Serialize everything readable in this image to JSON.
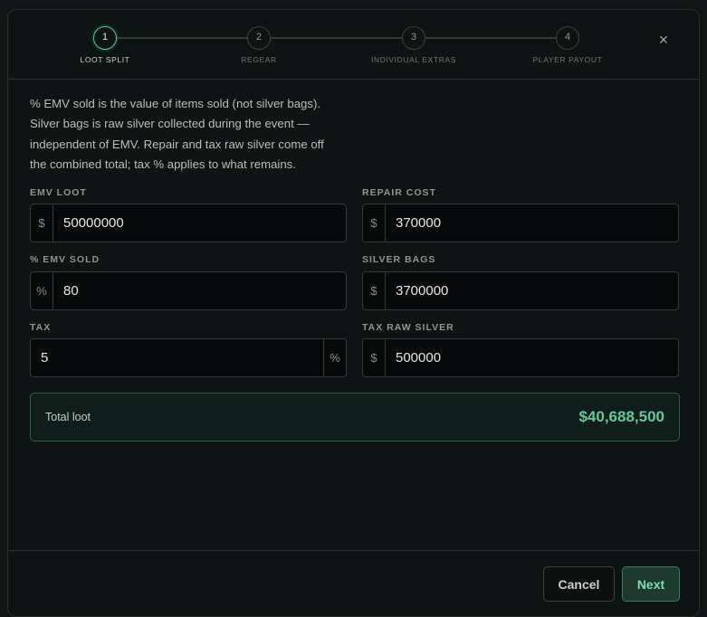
{
  "stepper": {
    "steps": [
      {
        "number": "1",
        "label": "LOOT SPLIT"
      },
      {
        "number": "2",
        "label": "REGEAR"
      },
      {
        "number": "3",
        "label": "INDIVIDUAL EXTRAS"
      },
      {
        "number": "4",
        "label": "PLAYER PAYOUT"
      }
    ],
    "active_step": 1,
    "close_symbol": "×"
  },
  "description": {
    "line1": "% EMV sold is the value of items sold (not silver bags).",
    "line2": "Silver bags is raw silver collected during the event —",
    "line3": "independent of EMV. Repair and tax raw silver come off",
    "line4": "the combined total; tax % applies to what remains."
  },
  "form": {
    "emv_loot": {
      "label": "EMV LOOT",
      "prefix": "$",
      "value": "50000000"
    },
    "repair_cost": {
      "label": "REPAIR COST",
      "prefix": "$",
      "value": "370000"
    },
    "emv_sold": {
      "label": "% EMV SOLD",
      "prefix": "%",
      "value": "80"
    },
    "silver_bags": {
      "label": "SILVER BAGS",
      "prefix": "$",
      "value": "3700000"
    },
    "tax": {
      "label": "TAX",
      "suffix": "%",
      "value": "5"
    },
    "tax_raw_silver": {
      "label": "TAX RAW SILVER",
      "prefix": "$",
      "value": "500000"
    }
  },
  "total": {
    "label": "Total loot",
    "value": "$40,688,500"
  },
  "footer": {
    "cancel_label": "Cancel",
    "next_label": "Next"
  },
  "colors": {
    "accent": "#66c79d",
    "background": "#0e1413",
    "border": "#26302d"
  },
  "icons": {
    "close": "close-icon"
  }
}
